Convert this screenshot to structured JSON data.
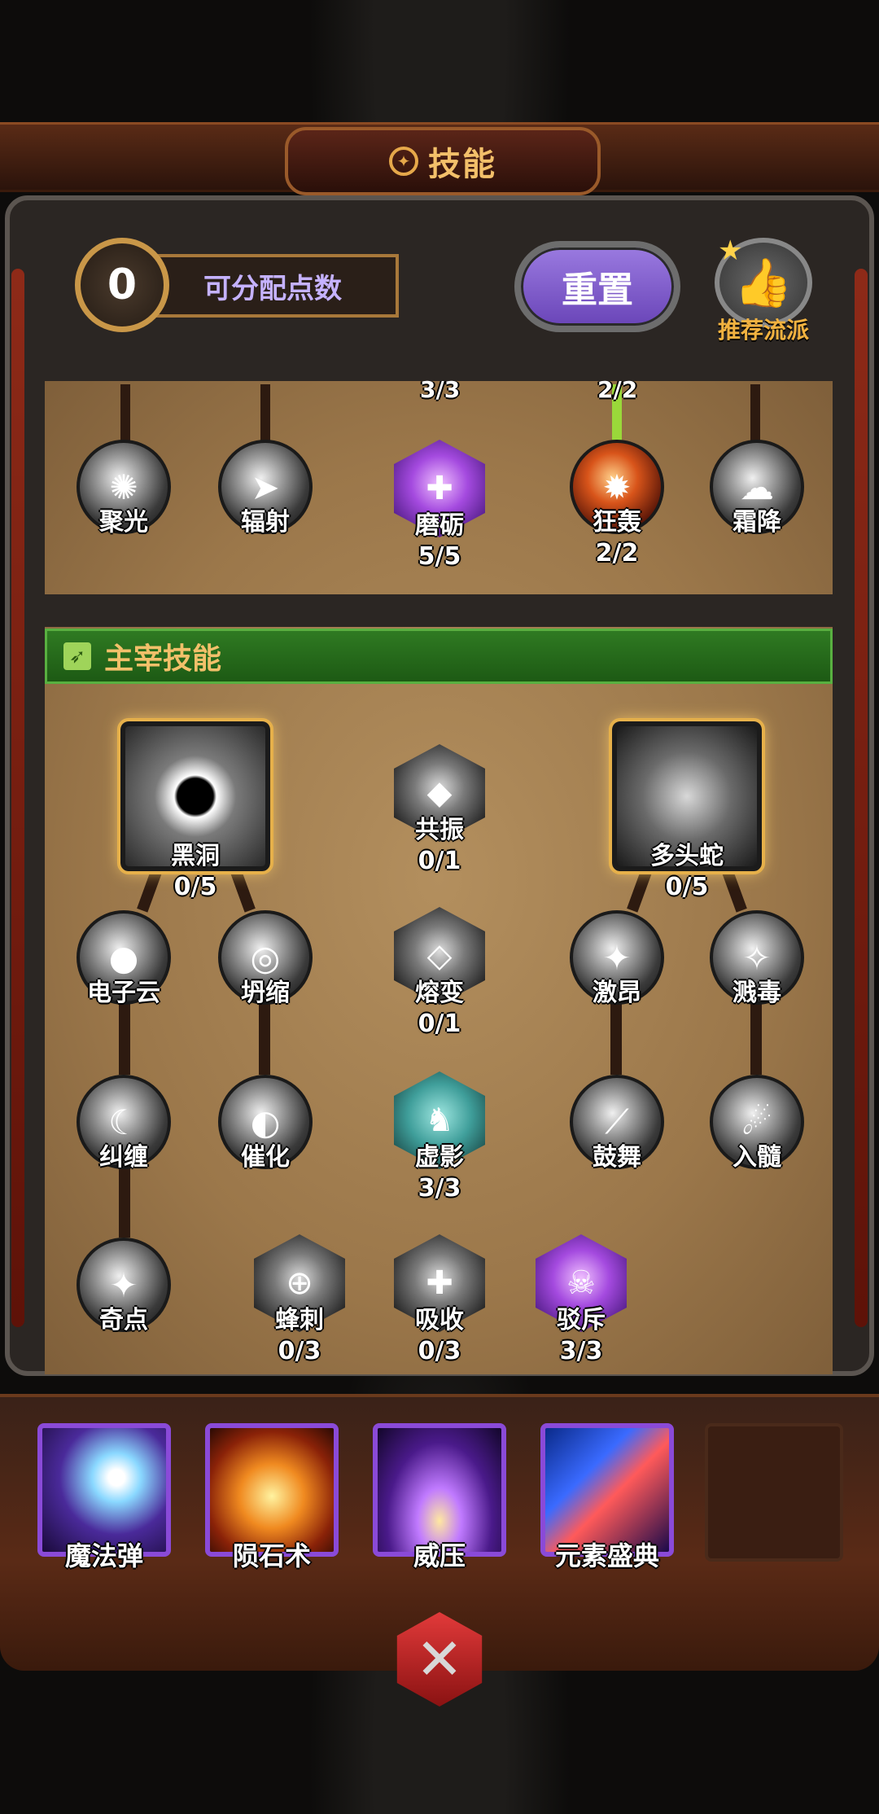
{
  "header": {
    "title": "技能"
  },
  "points": {
    "value": "0",
    "label": "可分配点数"
  },
  "reset_button": {
    "label": "重置"
  },
  "recommend": {
    "label": "推荐流派"
  },
  "top_tree": {
    "cut_levels": [
      "3/3",
      "2/2"
    ],
    "nodes": [
      {
        "name": "聚光",
        "level": ""
      },
      {
        "name": "辐射",
        "level": ""
      },
      {
        "name": "磨砺",
        "level": "5/5"
      },
      {
        "name": "狂轰",
        "level": "2/2"
      },
      {
        "name": "霜降",
        "level": ""
      }
    ]
  },
  "section": {
    "title": "主宰技能"
  },
  "master_tree": {
    "row1": [
      {
        "name": "黑洞",
        "level": "0/5"
      },
      {
        "name": "共振",
        "level": "0/1"
      },
      {
        "name": "多头蛇",
        "level": "0/5"
      }
    ],
    "row2": [
      {
        "name": "电子云",
        "level": ""
      },
      {
        "name": "坍缩",
        "level": ""
      },
      {
        "name": "熔变",
        "level": "0/1"
      },
      {
        "name": "激昂",
        "level": ""
      },
      {
        "name": "溅毒",
        "level": ""
      }
    ],
    "row3": [
      {
        "name": "纠缠",
        "level": ""
      },
      {
        "name": "催化",
        "level": ""
      },
      {
        "name": "虚影",
        "level": "3/3"
      },
      {
        "name": "鼓舞",
        "level": ""
      },
      {
        "name": "入髓",
        "level": ""
      }
    ],
    "row4": [
      {
        "name": "奇点",
        "level": ""
      },
      {
        "name": "蜂刺",
        "level": "0/3"
      },
      {
        "name": "吸收",
        "level": "0/3"
      },
      {
        "name": "驳斥",
        "level": "3/3"
      }
    ]
  },
  "equipped": [
    {
      "label": "魔法弹"
    },
    {
      "label": "陨石术"
    },
    {
      "label": "威压"
    },
    {
      "label": "元素盛典"
    }
  ]
}
